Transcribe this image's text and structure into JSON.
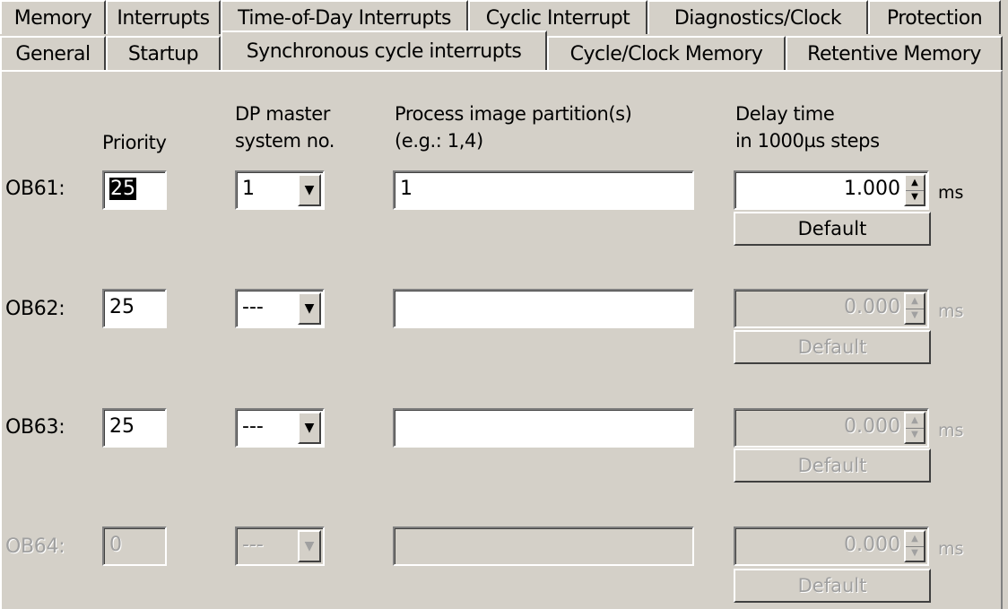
{
  "tabs_row1": [
    "Memory",
    "Interrupts",
    "Time-of-Day Interrupts",
    "Cyclic Interrupt",
    "Diagnostics/Clock",
    "Protection"
  ],
  "tabs_row2": [
    "General",
    "Startup",
    "Synchronous cycle interrupts",
    "Cycle/Clock Memory",
    "Retentive Memory"
  ],
  "active_tab": "Synchronous cycle interrupts",
  "headers": {
    "priority": "Priority",
    "dp_master_1": "DP master",
    "dp_master_2": "system no.",
    "partition_1": "Process image partition(s)",
    "partition_2": "(e.g.: 1,4)",
    "delay_1": "Delay time",
    "delay_2": "in 1000µs steps"
  },
  "rows": [
    {
      "label": "OB61:",
      "priority": "25",
      "dp_master": "1",
      "partition": "1",
      "delay": "1.000",
      "unit": "ms",
      "default_label": "Default",
      "enabled": true,
      "delay_enabled": true
    },
    {
      "label": "OB62:",
      "priority": "25",
      "dp_master": "---",
      "partition": "",
      "delay": "0.000",
      "unit": "ms",
      "default_label": "Default",
      "enabled": true,
      "delay_enabled": false
    },
    {
      "label": "OB63:",
      "priority": "25",
      "dp_master": "---",
      "partition": "",
      "delay": "0.000",
      "unit": "ms",
      "default_label": "Default",
      "enabled": true,
      "delay_enabled": false
    },
    {
      "label": "OB64:",
      "priority": "0",
      "dp_master": "---",
      "partition": "",
      "delay": "0.000",
      "unit": "ms",
      "default_label": "Default",
      "enabled": false,
      "delay_enabled": false
    }
  ],
  "icons": {
    "combo": "chevron-down-icon",
    "spin": "spinner-arrows-icon"
  }
}
